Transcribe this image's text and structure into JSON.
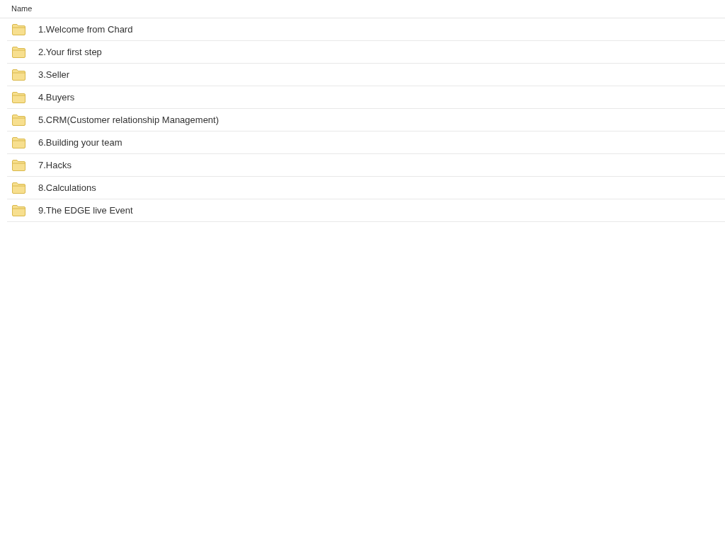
{
  "table": {
    "columns": [
      "Name"
    ],
    "rows": [
      {
        "name": "1.Welcome from Chard"
      },
      {
        "name": "2.Your first step"
      },
      {
        "name": "3.Seller"
      },
      {
        "name": "4.Buyers"
      },
      {
        "name": "5.CRM(Customer relationship Management)"
      },
      {
        "name": "6.Building your team"
      },
      {
        "name": "7.Hacks"
      },
      {
        "name": "8.Calculations"
      },
      {
        "name": "9.The EDGE live Event"
      }
    ]
  }
}
